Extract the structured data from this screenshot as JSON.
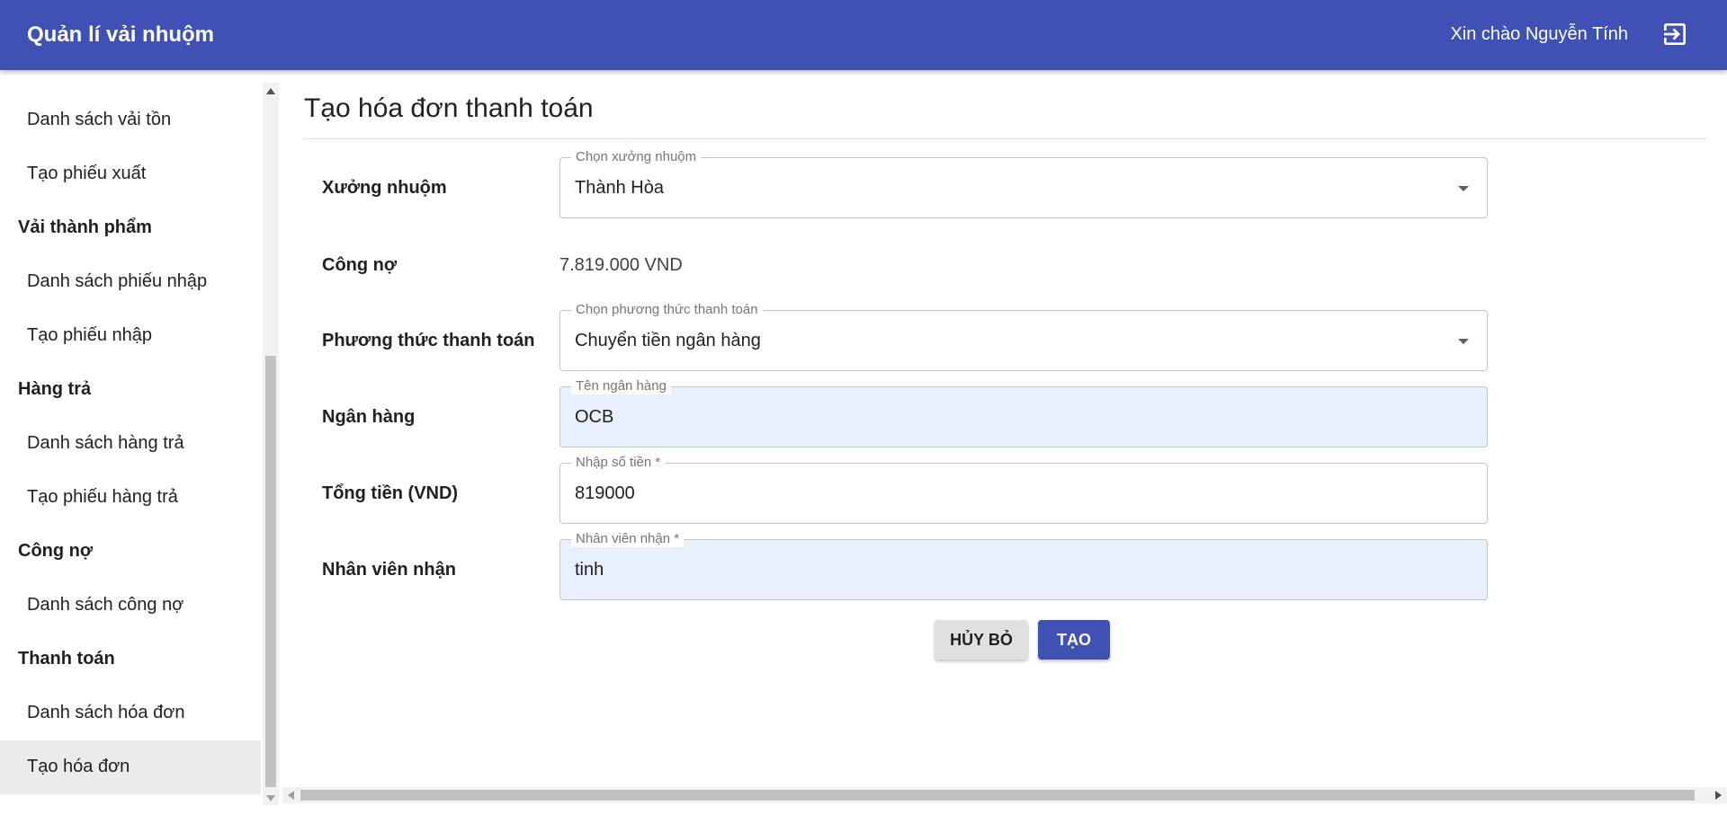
{
  "app": {
    "title": "Quản lí vải nhuộm",
    "greeting": "Xin chào Nguyễn Tính"
  },
  "sidebar": {
    "items": [
      {
        "label": "Danh sách vải tồn",
        "type": "sub"
      },
      {
        "label": "Tạo phiếu xuất",
        "type": "sub"
      },
      {
        "label": "Vải thành phẩm",
        "type": "group"
      },
      {
        "label": "Danh sách phiếu nhập",
        "type": "sub"
      },
      {
        "label": "Tạo phiếu nhập",
        "type": "sub"
      },
      {
        "label": "Hàng trả",
        "type": "group"
      },
      {
        "label": "Danh sách hàng trả",
        "type": "sub"
      },
      {
        "label": "Tạo phiếu hàng trả",
        "type": "sub"
      },
      {
        "label": "Công nợ",
        "type": "group"
      },
      {
        "label": "Danh sách công nợ",
        "type": "sub"
      },
      {
        "label": "Thanh toán",
        "type": "group"
      },
      {
        "label": "Danh sách hóa đơn",
        "type": "sub"
      },
      {
        "label": "Tạo hóa đơn",
        "type": "sub",
        "active": true
      }
    ]
  },
  "form": {
    "title": "Tạo hóa đơn thanh toán",
    "workshop": {
      "label": "Xưởng nhuộm",
      "legend": "Chọn xưởng nhuộm",
      "value": "Thành Hòa"
    },
    "debt": {
      "label": "Công nợ",
      "value": "7.819.000 VND"
    },
    "payment_method": {
      "label": "Phương thức thanh toán",
      "legend": "Chọn phương thức thanh toán",
      "value": "Chuyển tiền ngân hàng"
    },
    "bank": {
      "label": "Ngân hàng",
      "legend": "Tên ngân hàng",
      "value": "OCB"
    },
    "amount": {
      "label": "Tổng tiền (VND)",
      "legend": "Nhập số tiền *",
      "value": "819000"
    },
    "receiver": {
      "label": "Nhân viên nhận",
      "legend": "Nhân viên nhận *",
      "value": "tinh"
    },
    "cancel_label": "HỦY BỎ",
    "create_label": "TẠO"
  },
  "colors": {
    "primary": "#3f51b5",
    "active_item_bg": "#ebebeb",
    "autofill_bg": "#e8f0fe"
  },
  "icons": {
    "logout": "logout-icon",
    "dropdown": "arrow-drop-down-icon"
  }
}
